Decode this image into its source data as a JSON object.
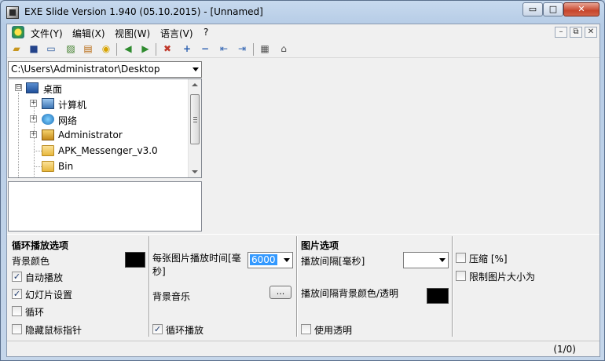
{
  "window": {
    "title": "EXE Slide Version 1.940 (05.10.2015) - [Unnamed]",
    "min_glyph": "▭",
    "max_glyph": "□",
    "close_glyph": "✕"
  },
  "menu": {
    "items": [
      "文件(Y)",
      "编辑(X)",
      "视图(W)",
      "语言(V)",
      "?"
    ],
    "mdi_min": "–",
    "mdi_restore": "⧉",
    "mdi_close": "✕"
  },
  "toolbar": {
    "icons": [
      "open-folder-icon",
      "save-icon",
      "window-icon",
      "image-icon",
      "edit-image-icon",
      "play-icon",
      "previous-icon",
      "next-icon",
      "delete-image-icon",
      "add-icon",
      "remove-icon",
      "move-left-icon",
      "move-right-icon",
      "grid-icon",
      "presentation-icon"
    ]
  },
  "browser": {
    "path": "C:\\Users\\Administrator\\Desktop",
    "tree": [
      {
        "label": "桌面",
        "icon": "desktop-icon",
        "toggle": "⊟"
      },
      {
        "label": "计算机",
        "icon": "computer-icon",
        "toggle": "+"
      },
      {
        "label": "网络",
        "icon": "network-icon",
        "toggle": "+"
      },
      {
        "label": "Administrator",
        "icon": "user-folder-icon",
        "toggle": "+"
      },
      {
        "label": "APK_Messenger_v3.0",
        "icon": "folder-icon",
        "toggle": ""
      },
      {
        "label": "Bin",
        "icon": "folder-icon",
        "toggle": ""
      }
    ]
  },
  "options": {
    "loop_section_title": "循环播放选项",
    "bg_color_label": "背景颜色",
    "autoplay_label": "自动播放",
    "autoplay_checked": true,
    "slideshow_label": "幻灯片设置",
    "slideshow_checked": true,
    "loop_label": "循环",
    "loop_checked": false,
    "hide_cursor_label": "隐藏鼠标指针",
    "hide_cursor_checked": false,
    "per_image_time_label": "每张图片播放时间[毫秒]",
    "per_image_time_value": "6000",
    "bg_music_label": "背景音乐",
    "browse_button": "...",
    "loop_play_label": "循环播放",
    "loop_play_checked": true,
    "image_section_title": "图片选项",
    "interval_label": "播放间隔[毫秒]",
    "interval_value": "",
    "interval_bg_label": "播放间隔背景颜色/透明",
    "use_transparent_label": "使用透明",
    "use_transparent_checked": false,
    "compress_label": "压缩 [%]",
    "compress_checked": false,
    "limit_size_label": "限制图片大小为",
    "limit_size_checked": false,
    "swatch_color": "#000000"
  },
  "status": {
    "counter": "(1/0)"
  }
}
